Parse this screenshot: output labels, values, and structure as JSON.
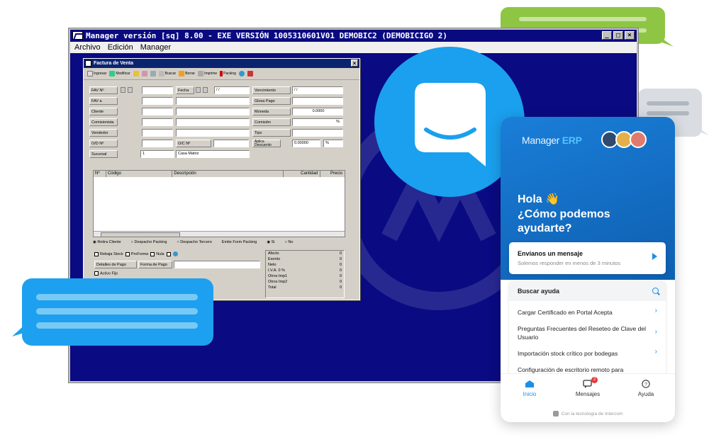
{
  "app": {
    "title": "Manager versión [sq] 8.00 - EXE VERSIÓN 1005310601V01 DEMOBIC2 (DEMOBICIGO 2)",
    "menu": [
      "Archivo",
      "Edición",
      "Manager"
    ]
  },
  "dialog": {
    "title": "Factura de Venta",
    "toolbar": [
      "Ingresar",
      "Modificar",
      "Buscar",
      "Borrar",
      "Imprime",
      "Packing"
    ],
    "labels": {
      "fav_no": "FAV Nº",
      "fav_a": "FAV a",
      "cliente": "Cliente",
      "comisionista": "Comisionista",
      "vendedor": "Vendedor",
      "od_no": "O/D Nº",
      "oc_no": "O/C Nº",
      "sucursal": "Sucursal",
      "fecha": "Fecha",
      "vencimiento": "Vencimiento",
      "glosa_pago": "Glosa Pago",
      "moneda": "Moneda",
      "comision": "Comisión",
      "tipo": "Tipo",
      "aplica_descuento": "Aplica Descuento"
    },
    "values": {
      "fecha": "/ /",
      "vencimiento": "/ /",
      "moneda": "0.0000",
      "comision_pct": "%",
      "descuento": "0.00000",
      "descuento_pct": "%",
      "sucursal_code": "1",
      "sucursal_name": "Casa Matriz"
    },
    "grid_headers": [
      "Nº",
      "Código",
      "Descripción",
      "Cantidad",
      "Precio"
    ],
    "radios": [
      "Retira Cliente",
      "Despacho Packing",
      "Despacho Tercero",
      "Emite Form Packing",
      "Si",
      "No"
    ],
    "checks": [
      "Rebaja Stock",
      "ProForma",
      "Nula"
    ],
    "detalles_pago": "Detalles de Pago",
    "forma_pago": "Forma de Pago",
    "activo_fijo": "Activo Fijo",
    "totals": [
      {
        "label": "Afecto",
        "value": "0"
      },
      {
        "label": "Exento",
        "value": "0"
      },
      {
        "label": "Neto",
        "value": "0"
      },
      {
        "label": "I.V.A. 0 %",
        "value": "0"
      },
      {
        "label": "Otros Imp1",
        "value": "0"
      },
      {
        "label": "Otros Imp2",
        "value": "0"
      },
      {
        "label": "Total",
        "value": "0"
      }
    ]
  },
  "widget": {
    "brand_prefix": "Manager",
    "brand_suffix": "ERP",
    "greeting": "Hola 👋",
    "question": "¿Cómo podemos ayudarte?",
    "send_title": "Envíanos un mensaje",
    "send_subtitle": "Solemos responder en menos de 3 minutos",
    "search_label": "Buscar ayuda",
    "help_items": [
      "Cargar Certificado en Portal Acepta",
      "Preguntas Frecuentes del Reseteo de Clave del Usuario",
      "Importación stock crítico por bodegas",
      "Configuración de escritorio remoto para"
    ],
    "nav": [
      {
        "label": "Inicio"
      },
      {
        "label": "Mensajes",
        "badge": "2"
      },
      {
        "label": "Ayuda"
      }
    ],
    "footer": "Con la tecnología de Intercom"
  },
  "colors": {
    "app_blue": "#0a0a82",
    "accent": "#1aa0ee",
    "green": "#8ec643"
  }
}
